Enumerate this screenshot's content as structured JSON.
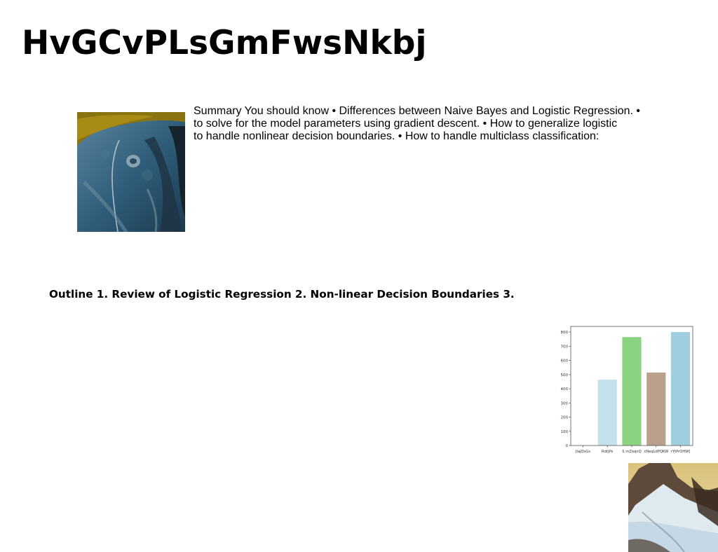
{
  "title": "HvGCvPLsGmFwsNkbj",
  "summary": {
    "lines": [
      "Summary You should know • Differences between Naive Bayes and Logistic Regression. •",
      "to solve for the model parameters using gradient descent. • How to generalize logistic",
      "to handle nonlinear decision boundaries. • How to handle multiclass classification:"
    ]
  },
  "outline": "Outline 1. Review of Logistic Regression 2. Non-linear Decision Boundaries 3.",
  "images": {
    "left_photo": "teal-ice-cave-photo-icon",
    "right_photo": "snowy-mountain-photo-icon"
  },
  "colors": {
    "bar_1": "#c4e1ec",
    "bar_2": "#8bd383",
    "bar_3": "#b8a08c",
    "bar_4": "#9fcfde"
  },
  "chart_data": {
    "type": "bar",
    "title": "",
    "xlabel": "",
    "ylabel": "",
    "categories": [
      "JlajQsGs",
      "RdrJPs",
      "S mZoqnQ",
      "cNeqLdPQKW",
      "rYtPrOHW]"
    ],
    "values": [
      0,
      465,
      765,
      515,
      800
    ],
    "ylim": [
      0,
      840
    ],
    "yticks": [
      "0",
      "100",
      "200",
      "300",
      "400",
      "500",
      "600",
      "700",
      "800"
    ],
    "grid": false,
    "legend": "none"
  }
}
